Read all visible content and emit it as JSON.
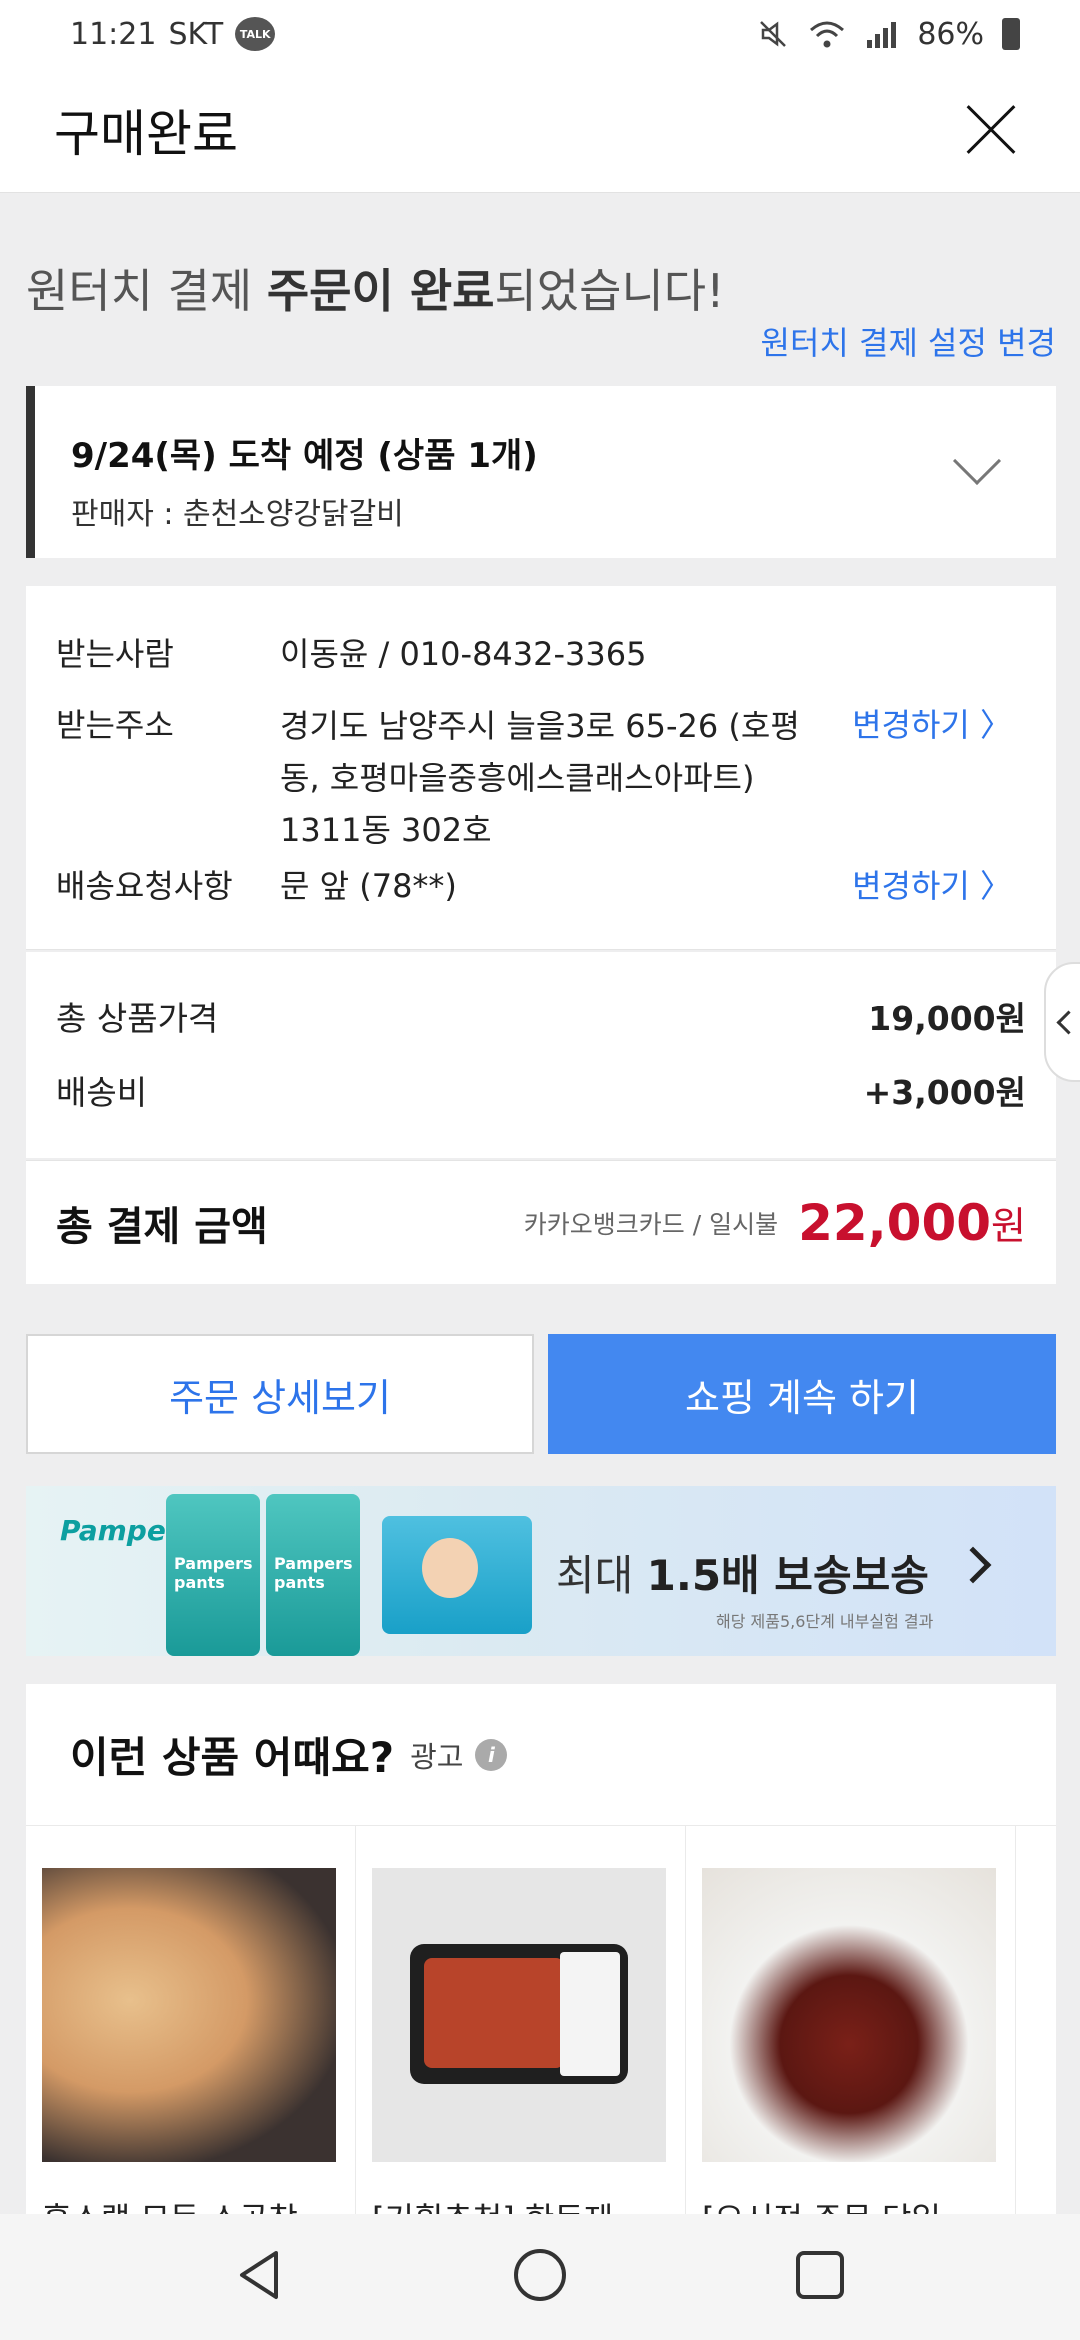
{
  "status_bar": {
    "time": "11:21",
    "carrier": "SKT",
    "talk": "TALK",
    "battery": "86%"
  },
  "header": {
    "title": "구매완료"
  },
  "headline": {
    "prefix": "원터치 결제 ",
    "bold": "주문이 완료",
    "suffix": "되었습니다!"
  },
  "settings_link": "원터치 결제 설정 변경",
  "delivery": {
    "title": "9/24(목) 도착 예정 (상품 1개)",
    "seller": "판매자 : 춘천소양강닭갈비"
  },
  "recipient": {
    "name_label": "받는사람",
    "name_value": "이동윤 / 010-8432-3365",
    "address_label": "받는주소",
    "address_value": "경기도 남양주시 늘을3로 65-26 (호평동, 호평마을중흥에스클래스아파트) 1311동 302호",
    "address_change": "변경하기 〉",
    "request_label": "배송요청사항",
    "request_value": "문 앞 (78**)",
    "request_change": "변경하기 〉"
  },
  "prices": {
    "product_label": "총 상품가격",
    "product_value": "19,000원",
    "shipping_label": "배송비",
    "shipping_value": "+3,000원"
  },
  "total": {
    "label": "총 결제 금액",
    "method": "카카오뱅크카드 / 일시불",
    "amount": "22,000",
    "unit": "원"
  },
  "buttons": {
    "detail": "주문 상세보기",
    "continue": "쇼핑 계속 하기"
  },
  "banner": {
    "brand": "Pampers",
    "pack_label": "Pampers pants",
    "text_prefix": "최대 ",
    "text_bold": "1.5배 보송보송",
    "note": "해당 제품5,6단계 내부실험 결과"
  },
  "recommend": {
    "title": "이런 상품 어때요?",
    "ad_label": "광고",
    "products": [
      {
        "name": "홍스랩 모등 소곱창"
      },
      {
        "name": "[기획추천] 한돈제"
      },
      {
        "name": "[오시전 주문 당일"
      }
    ]
  }
}
